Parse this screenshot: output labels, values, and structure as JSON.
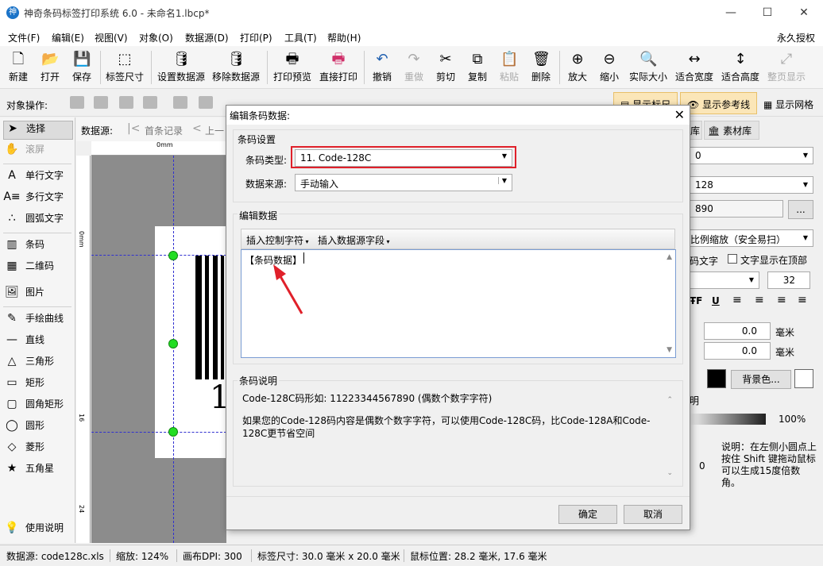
{
  "window": {
    "title": "神奇条码标签打印系统 6.0 - 未命名1.lbcp*",
    "app_icon_text": "神",
    "minimize": "—",
    "maximize": "☐",
    "close": "✕"
  },
  "menu": {
    "items": [
      "文件(F)",
      "编辑(E)",
      "视图(V)",
      "对象(O)",
      "数据源(D)",
      "打印(P)",
      "工具(T)",
      "帮助(H)"
    ],
    "license": "永久授权"
  },
  "toolbar": {
    "buttons": [
      {
        "label": "新建",
        "icon": "new-file-icon",
        "glyph": "🗋"
      },
      {
        "label": "打开",
        "icon": "open-icon",
        "glyph": "📂"
      },
      {
        "label": "保存",
        "icon": "save-icon",
        "glyph": "💾"
      },
      {
        "label": "标签尺寸",
        "icon": "label-size-icon",
        "glyph": "⬚"
      },
      {
        "label": "设置数据源",
        "icon": "database-settings-icon",
        "glyph": "🛢"
      },
      {
        "label": "移除数据源",
        "icon": "database-remove-icon",
        "glyph": "🛢"
      },
      {
        "label": "打印预览",
        "icon": "print-preview-icon",
        "glyph": "🖶"
      },
      {
        "label": "直接打印",
        "icon": "print-icon",
        "glyph": "🖶"
      },
      {
        "label": "撤销",
        "icon": "undo-icon",
        "glyph": "↶"
      },
      {
        "label": "重做",
        "icon": "redo-icon",
        "glyph": "↷"
      },
      {
        "label": "剪切",
        "icon": "cut-icon",
        "glyph": "✂"
      },
      {
        "label": "复制",
        "icon": "copy-icon",
        "glyph": "⧉"
      },
      {
        "label": "粘贴",
        "icon": "paste-icon",
        "glyph": "📋"
      },
      {
        "label": "删除",
        "icon": "delete-icon",
        "glyph": "🗑"
      },
      {
        "label": "放大",
        "icon": "zoom-in-icon",
        "glyph": "⊕"
      },
      {
        "label": "缩小",
        "icon": "zoom-out-icon",
        "glyph": "⊖"
      },
      {
        "label": "实际大小",
        "icon": "actual-size-icon",
        "glyph": "🔍"
      },
      {
        "label": "适合宽度",
        "icon": "fit-width-icon",
        "glyph": "↔"
      },
      {
        "label": "适合高度",
        "icon": "fit-height-icon",
        "glyph": "↕"
      },
      {
        "label": "整页显示",
        "icon": "full-page-icon",
        "glyph": "⤢"
      }
    ]
  },
  "objbar": {
    "label": "对象操作:",
    "show_ruler": "显示标尺",
    "show_guides": "显示参考线",
    "show_grid": "显示网格"
  },
  "lefttools": {
    "items": [
      {
        "label": "选择",
        "glyph": "➤"
      },
      {
        "label": "滚屏",
        "glyph": "✋"
      },
      {
        "label": "单行文字",
        "glyph": "A"
      },
      {
        "label": "多行文字",
        "glyph": "A≡"
      },
      {
        "label": "圆弧文字",
        "glyph": "∴"
      },
      {
        "label": "条码",
        "glyph": "▥"
      },
      {
        "label": "二维码",
        "glyph": "▦"
      },
      {
        "label": "图片",
        "glyph": "🖼"
      },
      {
        "label": "手绘曲线",
        "glyph": "✎"
      },
      {
        "label": "直线",
        "glyph": "—"
      },
      {
        "label": "三角形",
        "glyph": "△"
      },
      {
        "label": "矩形",
        "glyph": "▭"
      },
      {
        "label": "圆角矩形",
        "glyph": "▢"
      },
      {
        "label": "圆形",
        "glyph": "◯"
      },
      {
        "label": "菱形",
        "glyph": "◇"
      },
      {
        "label": "五角星",
        "glyph": "★"
      },
      {
        "label": "使用说明",
        "glyph": "💡"
      }
    ]
  },
  "datasource_bar": {
    "label": "数据源:",
    "first": "首条记录",
    "prev": "上一"
  },
  "canvas": {
    "ruler_h_zero": "0mm",
    "ruler_v_marks": [
      "0mm",
      "16",
      "24"
    ],
    "barcode_digit": "1"
  },
  "rightpanel": {
    "tab_lib": "库",
    "tab_material": "素材库",
    "combo1": "0",
    "combo2": "128",
    "field3": "890",
    "browse": "...",
    "scale_mode": "比例缩放（安全易扫）",
    "show_text": "码文字",
    "text_top": "文字显示在顶部",
    "font_size": "32",
    "strike": "ŦF",
    "underline": "U",
    "x_value": "0.0",
    "y_value": "0.0",
    "unit": "毫米",
    "bgcolor": "背景色...",
    "transparency_label": "明",
    "opacity": "100%",
    "angle": "0",
    "note": "说明：在左侧小圆点上按住 Shift 键拖动鼠标可以生成15度倍数角。"
  },
  "dialog": {
    "title": "编辑条码数据:",
    "close": "✕",
    "barcode_settings": {
      "title": "条码设置",
      "type_label": "条码类型:",
      "type_value": "11. Code-128C",
      "source_label": "数据来源:",
      "source_value": "手动输入"
    },
    "edit_data": {
      "title": "编辑数据",
      "insert_control": "插入控制字符",
      "insert_field": "插入数据源字段",
      "content": "【条码数据】"
    },
    "description": {
      "title": "条码说明",
      "line1": "Code-128C码形如: 11223344567890 (偶数个数字字符)",
      "line2": "如果您的Code-128码内容是偶数个数字字符，可以使用Code-128C码，比Code-128A和Code-128C更节省空间"
    },
    "ok": "确定",
    "cancel": "取消"
  },
  "statusbar": {
    "datasource": "数据源: code128c.xls",
    "zoom": "缩放: 124%",
    "dpi": "画布DPI: 300",
    "label_size": "标签尺寸: 30.0 毫米 x 20.0 毫米",
    "mouse_pos": "鼠标位置: 28.2 毫米, 17.6 毫米"
  },
  "colors": {
    "highlight_red": "#e0202a",
    "handle_green": "#22dd22",
    "selection_blue": "#3030d0"
  }
}
